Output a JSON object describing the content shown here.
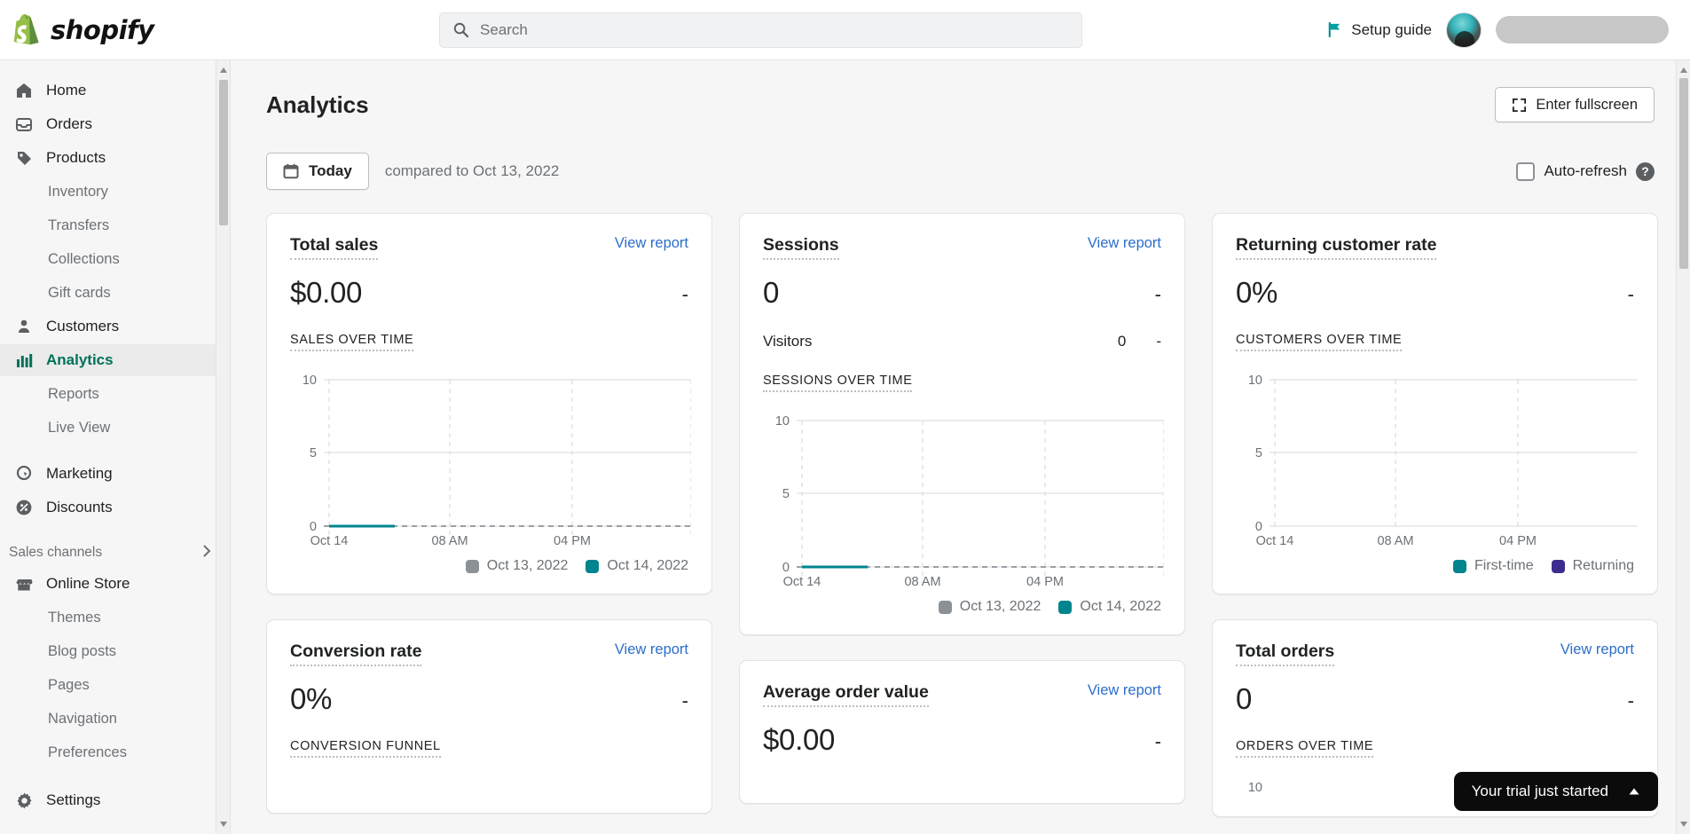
{
  "topbar": {
    "brand": "shopify",
    "search": {
      "placeholder": "Search",
      "icon": "search-icon"
    },
    "setup_guide": {
      "label": "Setup guide",
      "icon": "flag-icon"
    },
    "avatar_alt": "user-avatar",
    "store_name_redacted": ""
  },
  "sidebar": {
    "items": [
      {
        "label": "Home",
        "icon": "home-icon",
        "level": "top",
        "active": false
      },
      {
        "label": "Orders",
        "icon": "orders-icon",
        "level": "top",
        "active": false
      },
      {
        "label": "Products",
        "icon": "products-tag-icon",
        "level": "top",
        "active": false
      },
      {
        "label": "Inventory",
        "icon": "",
        "level": "sub",
        "active": false
      },
      {
        "label": "Transfers",
        "icon": "",
        "level": "sub",
        "active": false
      },
      {
        "label": "Collections",
        "icon": "",
        "level": "sub",
        "active": false
      },
      {
        "label": "Gift cards",
        "icon": "",
        "level": "sub",
        "active": false
      },
      {
        "label": "Customers",
        "icon": "customers-icon",
        "level": "top",
        "active": false
      },
      {
        "label": "Analytics",
        "icon": "analytics-bars-icon",
        "level": "top",
        "active": true
      },
      {
        "label": "Reports",
        "icon": "",
        "level": "sub",
        "active": false
      },
      {
        "label": "Live View",
        "icon": "",
        "level": "sub",
        "active": false
      },
      {
        "label": "Marketing",
        "icon": "marketing-icon",
        "level": "top",
        "active": false
      },
      {
        "label": "Discounts",
        "icon": "discounts-icon",
        "level": "top",
        "active": false
      }
    ],
    "section": {
      "label": "Sales channels",
      "icon": "chevron-right-icon"
    },
    "channel_items": [
      {
        "label": "Online Store",
        "icon": "store-icon",
        "level": "top"
      },
      {
        "label": "Themes",
        "icon": "",
        "level": "sub"
      },
      {
        "label": "Blog posts",
        "icon": "",
        "level": "sub"
      },
      {
        "label": "Pages",
        "icon": "",
        "level": "sub"
      },
      {
        "label": "Navigation",
        "icon": "",
        "level": "sub"
      },
      {
        "label": "Preferences",
        "icon": "",
        "level": "sub"
      }
    ],
    "settings": {
      "label": "Settings",
      "icon": "gear-icon"
    },
    "active_color": "#00715a"
  },
  "page": {
    "title": "Analytics",
    "fullscreen_button": {
      "label": "Enter fullscreen",
      "icon": "fullscreen-icon"
    },
    "date_button": {
      "label": "Today",
      "icon": "calendar-icon"
    },
    "compared_to": "compared to Oct 13, 2022",
    "auto_refresh": {
      "label": "Auto-refresh",
      "checked": false,
      "help_icon": "question-mark-icon"
    }
  },
  "colors": {
    "teal": "#00848e",
    "gray_compare": "#8c9196",
    "purple": "#3b2c8d",
    "link_blue": "#2c6ecb",
    "accent_green": "#00715a"
  },
  "cards": {
    "total_sales": {
      "title": "Total sales",
      "view_report": "View report",
      "value": "$0.00",
      "delta": "-",
      "chart_label": "SALES OVER TIME",
      "legend": [
        {
          "label": "Oct 13, 2022",
          "color": "#8c9196"
        },
        {
          "label": "Oct 14, 2022",
          "color": "#00848e"
        }
      ]
    },
    "sessions": {
      "title": "Sessions",
      "view_report": "View report",
      "value": "0",
      "delta": "-",
      "visitors_label": "Visitors",
      "visitors_value": "0",
      "visitors_delta": "-",
      "chart_label": "SESSIONS OVER TIME",
      "legend": [
        {
          "label": "Oct 13, 2022",
          "color": "#8c9196"
        },
        {
          "label": "Oct 14, 2022",
          "color": "#00848e"
        }
      ]
    },
    "returning_customer_rate": {
      "title": "Returning customer rate",
      "value": "0%",
      "delta": "-",
      "chart_label": "CUSTOMERS OVER TIME",
      "legend": [
        {
          "label": "First-time",
          "color": "#00848e"
        },
        {
          "label": "Returning",
          "color": "#3b2c8d"
        }
      ]
    },
    "conversion_rate": {
      "title": "Conversion rate",
      "view_report": "View report",
      "value": "0%",
      "delta": "-",
      "chart_label": "CONVERSION FUNNEL"
    },
    "average_order_value": {
      "title": "Average order value",
      "view_report": "View report",
      "value": "$0.00",
      "delta": "-"
    },
    "total_orders": {
      "title": "Total orders",
      "view_report": "View report",
      "value": "0",
      "delta": "-",
      "chart_label": "ORDERS OVER TIME"
    }
  },
  "trial_banner": {
    "label": "Your trial just started",
    "icon": "chevron-up-icon"
  },
  "chart_data": [
    {
      "id": "sales_over_time",
      "type": "line",
      "title": "SALES OVER TIME",
      "xlabel": "",
      "ylabel": "",
      "ylim": [
        0,
        10
      ],
      "yticks": [
        0,
        5,
        10
      ],
      "xticks": [
        "Oct 14",
        "08 AM",
        "04 PM"
      ],
      "grid": true,
      "legend_position": "bottom-right",
      "series": [
        {
          "name": "Oct 14, 2022",
          "color": "#00848e",
          "style": "solid",
          "partial_to": 0.18,
          "values": [
            0,
            0,
            0,
            0,
            0
          ]
        },
        {
          "name": "Oct 13, 2022",
          "color": "#8c9196",
          "style": "dashed",
          "values": [
            0,
            0,
            0,
            0,
            0,
            0,
            0,
            0,
            0,
            0
          ]
        }
      ]
    },
    {
      "id": "sessions_over_time",
      "type": "line",
      "title": "SESSIONS OVER TIME",
      "xlabel": "",
      "ylabel": "",
      "ylim": [
        0,
        10
      ],
      "yticks": [
        0,
        5,
        10
      ],
      "xticks": [
        "Oct 14",
        "08 AM",
        "04 PM"
      ],
      "grid": true,
      "legend_position": "bottom-right",
      "series": [
        {
          "name": "Oct 14, 2022",
          "color": "#00848e",
          "style": "solid",
          "partial_to": 0.18,
          "values": [
            0,
            0,
            0,
            0,
            0
          ]
        },
        {
          "name": "Oct 13, 2022",
          "color": "#8c9196",
          "style": "dashed",
          "values": [
            0,
            0,
            0,
            0,
            0,
            0,
            0,
            0,
            0,
            0
          ]
        }
      ]
    },
    {
      "id": "customers_over_time",
      "type": "line",
      "title": "CUSTOMERS OVER TIME",
      "xlabel": "",
      "ylabel": "",
      "ylim": [
        0,
        10
      ],
      "yticks": [
        0,
        5,
        10
      ],
      "xticks": [
        "Oct 14",
        "08 AM",
        "04 PM"
      ],
      "grid": true,
      "legend_position": "bottom-right",
      "series": [
        {
          "name": "First-time",
          "color": "#00848e",
          "values": []
        },
        {
          "name": "Returning",
          "color": "#3b2c8d",
          "values": []
        }
      ]
    }
  ]
}
